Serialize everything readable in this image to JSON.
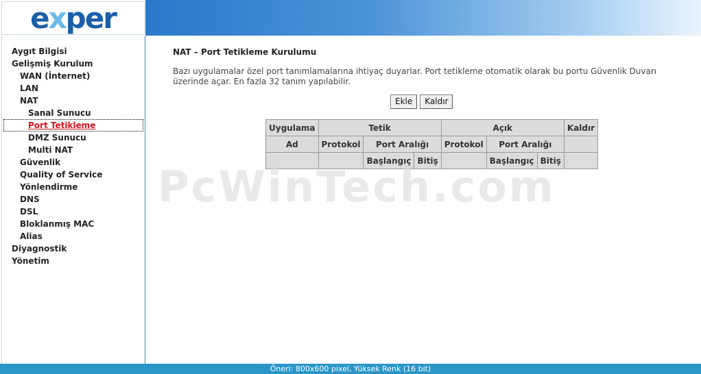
{
  "header": {
    "logo_prefix": "e",
    "logo_x": "x",
    "logo_suffix": "per"
  },
  "sidebar": {
    "items": [
      {
        "label": "Aygıt Bilgisi"
      },
      {
        "label": "Gelişmiş Kurulum"
      },
      {
        "label": "WAN (İnternet)"
      },
      {
        "label": "LAN"
      },
      {
        "label": "NAT"
      },
      {
        "label": "Sanal Sunucu"
      },
      {
        "label": "Port Tetikleme"
      },
      {
        "label": "DMZ Sunucu"
      },
      {
        "label": "Multi NAT"
      },
      {
        "label": "Güvenlik"
      },
      {
        "label": "Quality of Service"
      },
      {
        "label": "Yönlendirme"
      },
      {
        "label": "DNS"
      },
      {
        "label": "DSL"
      },
      {
        "label": "Bloklanmış MAC"
      },
      {
        "label": "Alias"
      },
      {
        "label": "Diyagnostik"
      },
      {
        "label": "Yönetim"
      }
    ]
  },
  "main": {
    "title": "NAT – Port Tetikleme Kurulumu",
    "description": "Bazı uygulamalar özel port tanımlamalarına ihtiyaç duyarlar. Port tetikleme otomatik olarak bu portu Güvenlik Duvarı üzerinde açar. En fazla 32 tanım yapılabilir.",
    "add_button": "Ekle",
    "remove_button": "Kaldır"
  },
  "table": {
    "col_application": "Uygulama",
    "col_trigger": "Tetik",
    "col_open": "Açık",
    "col_remove": "Kaldır",
    "col_name": "Ad",
    "col_trigger_protocol": "Protokol",
    "col_trigger_range": "Port Aralığı",
    "col_open_protocol": "Protokol",
    "col_open_range": "Port Aralığı",
    "col_trigger_start": "Başlangıç",
    "col_trigger_end": "Bitiş",
    "col_open_start": "Başlangıç",
    "col_open_end": "Bitiş"
  },
  "watermark": "PcWinTech.com",
  "footer": {
    "text": "Öneri: 800x600 pixel, Yüksek Renk (16 bit)"
  }
}
